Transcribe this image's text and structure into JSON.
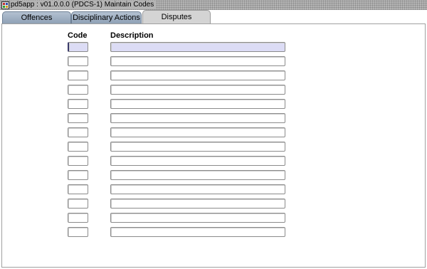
{
  "window": {
    "title": "pd5app : v01.0.0.0 (PDCS-1) Maintain Codes"
  },
  "tabs": [
    {
      "label": "Offences",
      "active": false
    },
    {
      "label": "Disciplinary Actions",
      "active": false
    },
    {
      "label": "Disputes",
      "active": true
    }
  ],
  "grid": {
    "code_header": "Code",
    "description_header": "Description",
    "rows": [
      {
        "code": "",
        "description": ""
      },
      {
        "code": "",
        "description": ""
      },
      {
        "code": "",
        "description": ""
      },
      {
        "code": "",
        "description": ""
      },
      {
        "code": "",
        "description": ""
      },
      {
        "code": "",
        "description": ""
      },
      {
        "code": "",
        "description": ""
      },
      {
        "code": "",
        "description": ""
      },
      {
        "code": "",
        "description": ""
      },
      {
        "code": "",
        "description": ""
      },
      {
        "code": "",
        "description": ""
      },
      {
        "code": "",
        "description": ""
      },
      {
        "code": "",
        "description": ""
      },
      {
        "code": "",
        "description": ""
      }
    ]
  },
  "colors": {
    "current_row": "#dcdcf5",
    "inactive_tab": "#a3b3c6",
    "active_tab": "#d4d4d4"
  },
  "icons": {
    "app": "oracle-forms-app-icon"
  }
}
